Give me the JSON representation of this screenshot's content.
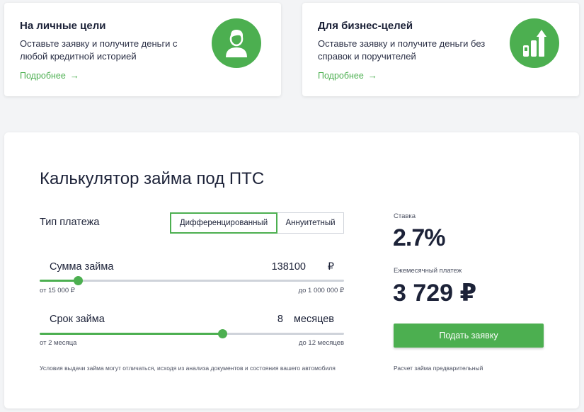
{
  "cards": {
    "personal": {
      "title": "На личные цели",
      "text": "Оставьте заявку и получите деньги с любой кредитной историей",
      "link": "Подробнее",
      "icon": "person-icon"
    },
    "business": {
      "title": "Для бизнес-целей",
      "text": "Оставьте заявку и получите деньги без справок и поручителей",
      "link": "Подробнее",
      "icon": "growth-chart-icon"
    }
  },
  "calculator": {
    "title": "Калькулятор займа под ПТС",
    "payment_type": {
      "label": "Тип платежа",
      "options": [
        "Дифференцированный",
        "Аннуитетный"
      ],
      "selected": "Дифференцированный"
    },
    "amount": {
      "label": "Сумма займа",
      "value": "138100",
      "unit": "₽",
      "min_label": "от 15 000 ₽",
      "max_label": "до 1 000 000 ₽",
      "fill_fraction": 0.125
    },
    "term": {
      "label": "Срок займа",
      "value": "8",
      "unit": "месяцев",
      "min_label": "от 2 месяца",
      "max_label": "до 12 месяцев",
      "fill_fraction": 0.6
    },
    "disclaimer": "Условия выдачи займа могут отличаться, исходя из анализа документов и состояния вашего автомобиля",
    "rate_label": "Ставка",
    "rate_value": "2.7%",
    "payment_label": "Ежемесячный платеж",
    "payment_value": "3 729 ₽",
    "submit_label": "Подать заявку",
    "note": "Расчет займа предварительный"
  },
  "colors": {
    "accent": "#4caf50",
    "text": "#1c2238",
    "track": "#cfd3da"
  }
}
